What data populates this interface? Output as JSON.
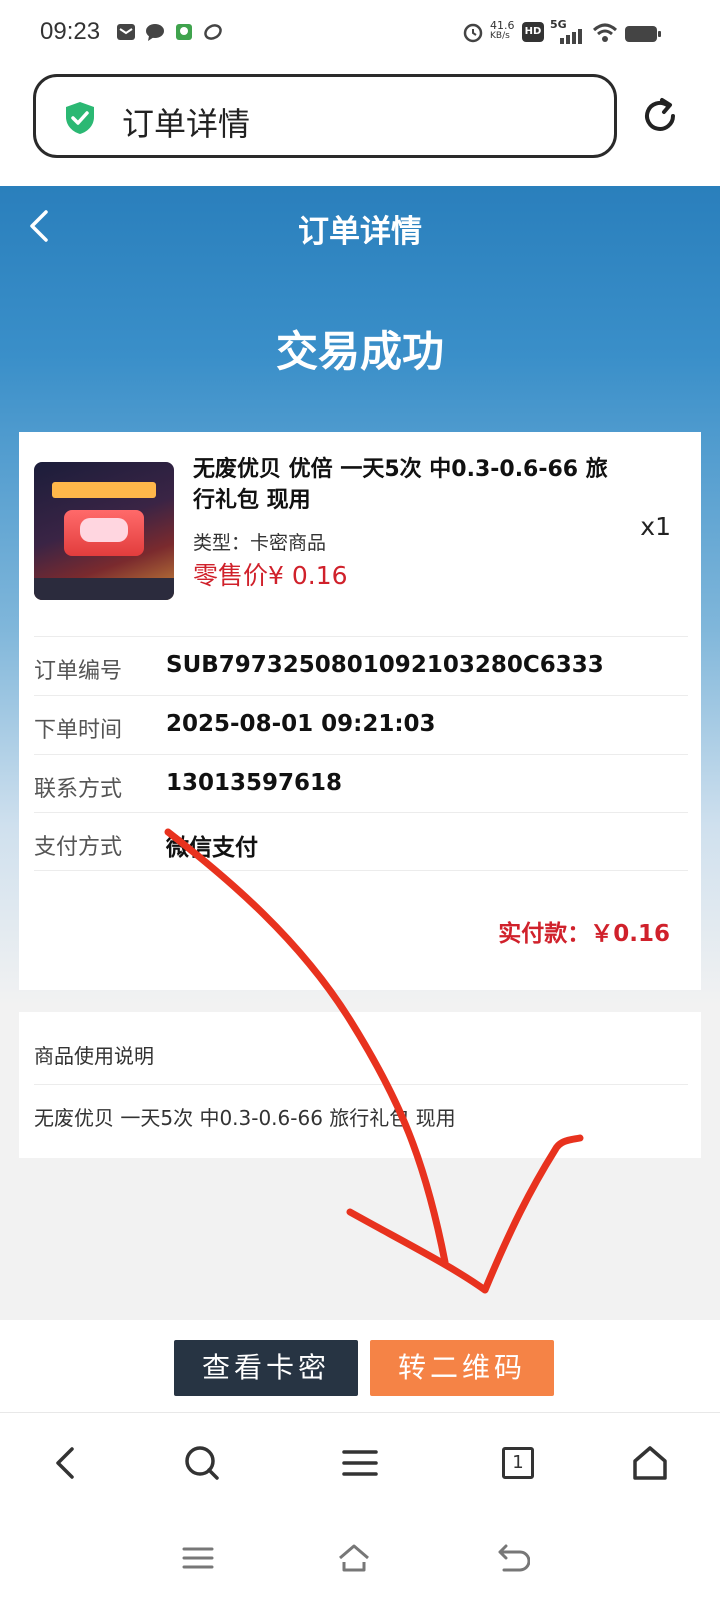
{
  "status_bar": {
    "time": "09:23",
    "net_speed": "41.6",
    "net_unit": "KB/s",
    "hd": "HD",
    "network": "5G"
  },
  "address_bar": {
    "text": "订单详情"
  },
  "header": {
    "title": "订单详情",
    "status": "交易成功"
  },
  "product": {
    "title": "无废优贝 优倍 一天5次 中0.3-0.6-66 旅行礼包 现用",
    "type": "类型：卡密商品",
    "price": "零售价¥ 0.16",
    "quantity": "x1"
  },
  "order_info": [
    {
      "label": "订单编号",
      "value": "SUB7973250801092103280C6333"
    },
    {
      "label": "下单时间",
      "value": "2025-08-01 09:21:03"
    },
    {
      "label": "联系方式",
      "value": "13013597618"
    },
    {
      "label": "支付方式",
      "value": "微信支付"
    }
  ],
  "paid": {
    "text": "实付款：￥0.16"
  },
  "usage": {
    "title": "商品使用说明",
    "text": "无废优贝 一天5次 中0.3-0.6-66 旅行礼包 现用"
  },
  "actions": {
    "view_card_label": "查看卡密",
    "qr_label": "转二维码"
  },
  "browser_nav": {
    "tab_count": "1"
  },
  "colors": {
    "header_blue": "#2a7fbc",
    "price_red": "#d0212b",
    "btn_dark": "#273443",
    "btn_orange": "#f58346",
    "annotation_red": "#e8321e"
  }
}
